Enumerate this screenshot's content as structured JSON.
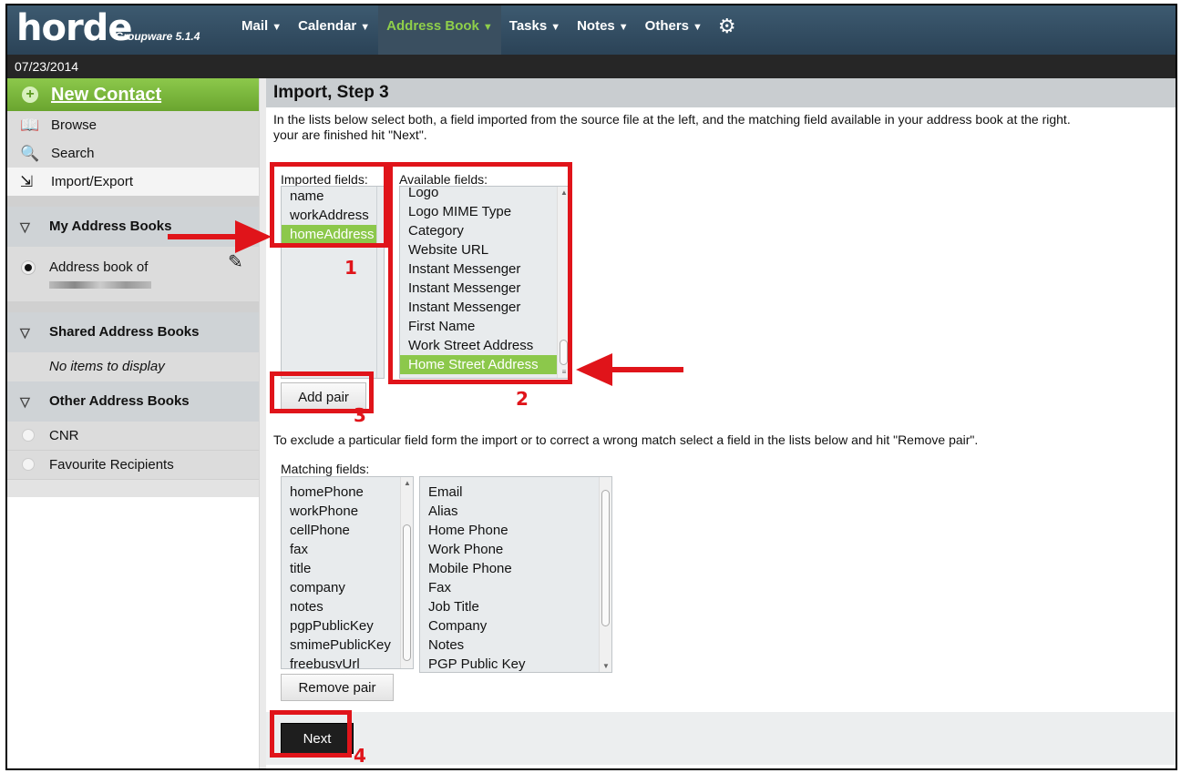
{
  "header": {
    "logo": "horde",
    "product": "Groupware 5.1.4",
    "nav": [
      {
        "label": "Mail",
        "active": false
      },
      {
        "label": "Calendar",
        "active": false
      },
      {
        "label": "Address Book",
        "active": true
      },
      {
        "label": "Tasks",
        "active": false
      },
      {
        "label": "Notes",
        "active": false
      },
      {
        "label": "Others",
        "active": false
      }
    ],
    "date": "07/23/2014"
  },
  "sidebar": {
    "new_contact": "New Contact",
    "links": [
      {
        "label": "Browse",
        "icon": "book-icon"
      },
      {
        "label": "Search",
        "icon": "search-icon"
      },
      {
        "label": "Import/Export",
        "icon": "import-export-icon"
      }
    ],
    "my_books_title": "My Address Books",
    "my_book": "Address book of",
    "shared_title": "Shared Address Books",
    "shared_empty": "No items to display",
    "other_title": "Other Address Books",
    "other_items": [
      "CNR",
      "Favourite Recipients"
    ]
  },
  "main": {
    "title": "Import, Step 3",
    "intro_line1": "In the lists below select both, a field imported from the source file at the left, and the matching field available in your address book at the right.",
    "intro_line2": "your are finished hit \"Next\".",
    "imported_label": "Imported fields:",
    "available_label": "Available fields:",
    "imported_fields": [
      "name",
      "workAddress",
      "homeAddress"
    ],
    "imported_selected": "homeAddress",
    "available_fields": [
      "Logo",
      "Logo MIME Type",
      "Category",
      "Website URL",
      "Instant Messenger",
      "Instant Messenger",
      "Instant Messenger",
      "First Name",
      "Work Street Address",
      "Home Street Address"
    ],
    "available_selected": "Home Street Address",
    "add_pair": "Add pair",
    "exclude_text": "To exclude a particular field form the import or to correct a wrong match select a field in the lists below and hit \"Remove pair\".",
    "matching_label": "Matching fields:",
    "matching_left": [
      "homePhone",
      "workPhone",
      "cellPhone",
      "fax",
      "title",
      "company",
      "notes",
      "pgpPublicKey",
      "smimePublicKey",
      "freebusyUrl"
    ],
    "matching_right": [
      "Email",
      "Alias",
      "Home Phone",
      "Work Phone",
      "Mobile Phone",
      "Fax",
      "Job Title",
      "Company",
      "Notes",
      "PGP Public Key"
    ],
    "remove_pair": "Remove pair",
    "next": "Next"
  },
  "annotations": {
    "n1": "1",
    "n2": "2",
    "n3": "3",
    "n4": "4",
    "color": "#e0141a"
  }
}
